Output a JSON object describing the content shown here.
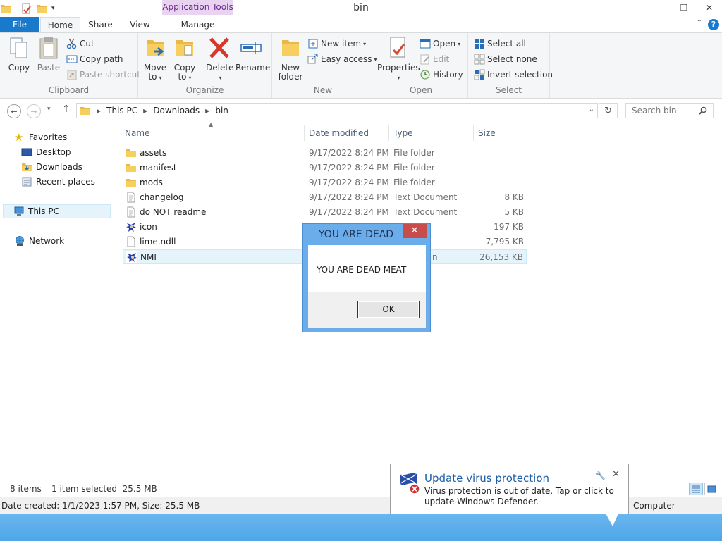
{
  "window": {
    "title": "bin",
    "context_tab": "Application Tools",
    "minimize": "—",
    "restore": "❐",
    "close": "✕"
  },
  "tabs": {
    "file": "File",
    "home": "Home",
    "share": "Share",
    "view": "View",
    "manage": "Manage",
    "help": "?"
  },
  "ribbon": {
    "clipboard": {
      "label": "Clipboard",
      "copy": "Copy",
      "paste": "Paste",
      "cut": "Cut",
      "copy_path": "Copy path",
      "paste_shortcut": "Paste shortcut"
    },
    "organize": {
      "label": "Organize",
      "move_to_1": "Move",
      "move_to_2": "to",
      "copy_to_1": "Copy",
      "copy_to_2": "to",
      "delete": "Delete",
      "rename": "Rename"
    },
    "new": {
      "label": "New",
      "new_folder_1": "New",
      "new_folder_2": "folder",
      "new_item": "New item",
      "easy_access": "Easy access"
    },
    "open": {
      "label": "Open",
      "properties": "Properties",
      "open": "Open",
      "edit": "Edit",
      "history": "History"
    },
    "select": {
      "label": "Select",
      "select_all": "Select all",
      "select_none": "Select none",
      "invert_selection": "Invert selection"
    }
  },
  "address": {
    "crumbs": [
      "This PC",
      "Downloads",
      "bin"
    ],
    "search_placeholder": "Search bin"
  },
  "nav": {
    "favorites": "Favorites",
    "desktop": "Desktop",
    "downloads": "Downloads",
    "recent_places": "Recent places",
    "this_pc": "This PC",
    "network": "Network"
  },
  "columns": {
    "name": "Name",
    "date_modified": "Date modified",
    "type": "Type",
    "size": "Size"
  },
  "files": [
    {
      "name": "assets",
      "date": "9/17/2022 8:24 PM",
      "type": "File folder",
      "size": "",
      "icon": "folder-icon"
    },
    {
      "name": "manifest",
      "date": "9/17/2022 8:24 PM",
      "type": "File folder",
      "size": "",
      "icon": "folder-icon"
    },
    {
      "name": "mods",
      "date": "9/17/2022 8:24 PM",
      "type": "File folder",
      "size": "",
      "icon": "folder-icon"
    },
    {
      "name": "changelog",
      "date": "9/17/2022 8:24 PM",
      "type": "Text Document",
      "size": "8 KB",
      "icon": "text-file-icon"
    },
    {
      "name": "do NOT readme",
      "date": "9/17/2022 8:24 PM",
      "type": "Text Document",
      "size": "5 KB",
      "icon": "text-file-icon"
    },
    {
      "name": "icon",
      "date": "",
      "type": "",
      "size": "197 KB",
      "icon": "sonic-icon"
    },
    {
      "name": "lime.ndll",
      "date": "",
      "type": "",
      "size": "7,795 KB",
      "icon": "file-icon"
    },
    {
      "name": "NMI",
      "date": "",
      "type": "n",
      "size": "26,153 KB",
      "icon": "sonic-icon"
    }
  ],
  "status": {
    "items": "8 items",
    "selected": "1 item selected  25.5 MB"
  },
  "details": {
    "text": "Date created: 1/1/2023 1:57 PM, Size: 25.5 MB",
    "location": "Computer"
  },
  "dialog": {
    "title": "YOU ARE DEAD",
    "message": "YOU ARE DEAD MEAT",
    "ok": "OK",
    "close": "✕"
  },
  "toast": {
    "title": "Update virus protection",
    "message": "Virus protection is out of date. Tap or click to update Windows Defender."
  },
  "colors": {
    "accent": "#1979ca",
    "taskbar": "#5aaeeb",
    "dialog_frame": "#6badeb",
    "close_red": "#c74d4d"
  }
}
